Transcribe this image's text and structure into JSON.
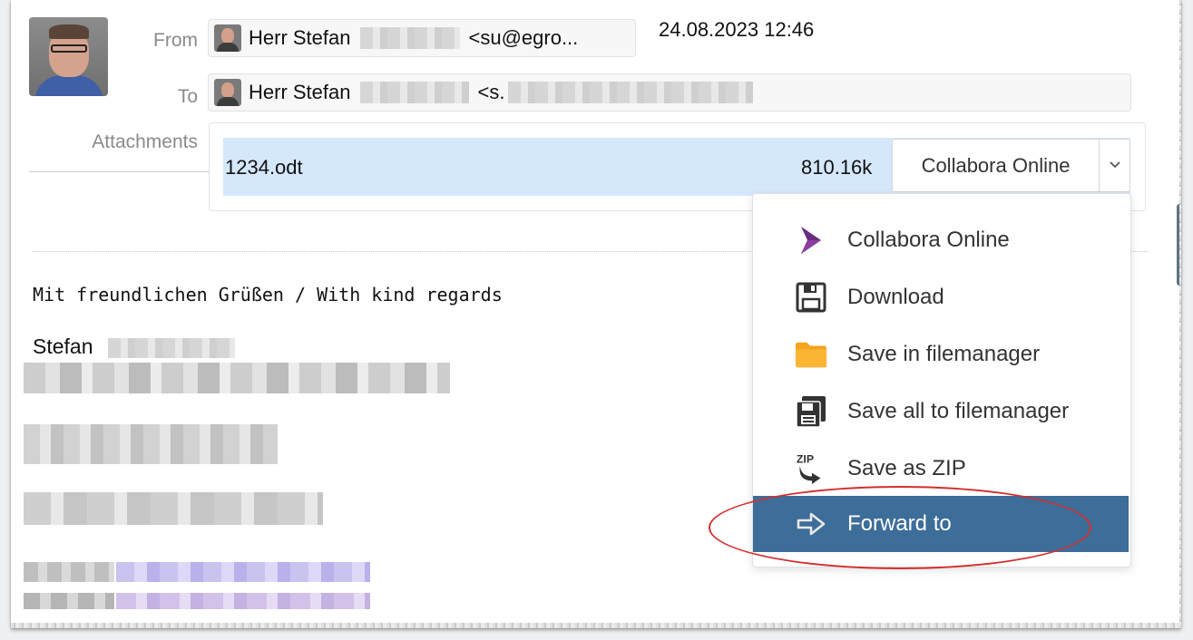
{
  "header": {
    "from_label": "From",
    "to_label": "To",
    "attachments_label": "Attachments",
    "from_name": "Herr Stefan",
    "from_email": "<su@egro...",
    "to_name": "Herr Stefan",
    "to_email": "<s.",
    "date": "24.08.2023 12:46"
  },
  "attachment": {
    "filename": "1234.odt",
    "size": "810.16k",
    "open_with": "Collabora Online"
  },
  "menu": {
    "items": [
      {
        "label": "Collabora Online",
        "icon": "collabora-icon"
      },
      {
        "label": "Download",
        "icon": "save-disk-icon"
      },
      {
        "label": "Save in filemanager",
        "icon": "folder-icon"
      },
      {
        "label": "Save all to filemanager",
        "icon": "save-all-icon"
      },
      {
        "label": "Save as ZIP",
        "icon": "zip-icon"
      },
      {
        "label": "Forward to",
        "icon": "forward-arrow-icon"
      }
    ],
    "active_item": "Forward to"
  },
  "body": {
    "greeting": "Mit freundlichen Grüßen / With kind regards",
    "signature_name": "Stefan"
  },
  "colors": {
    "attachment_row": "#d5e7fb",
    "menu_active": "#3d6d99",
    "annotation": "#d32f2f"
  }
}
